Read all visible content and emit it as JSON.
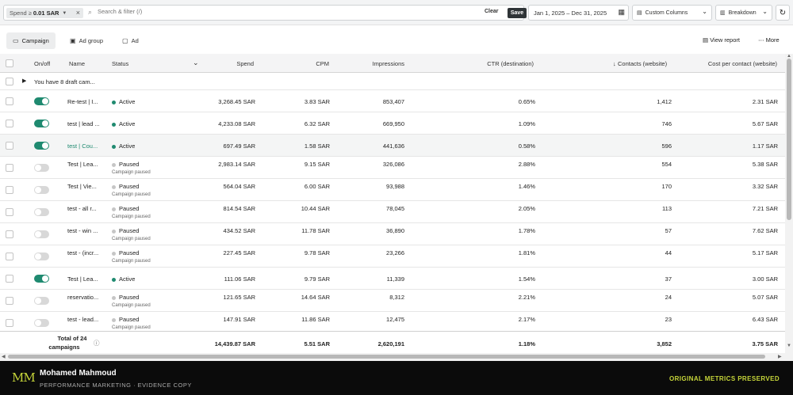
{
  "filter": {
    "chip_label": "Spend ≥",
    "chip_value": "0.01 SAR",
    "search_placeholder": "Search & filter (/)",
    "clear_label": "Clear",
    "save_label": "Save"
  },
  "date_range": "Jan 1, 2025 – Dec 31, 2025",
  "custom_columns_label": "Custom Columns",
  "breakdown_label": "Breakdown",
  "tabs": [
    {
      "label": "Campaign"
    },
    {
      "label": "Ad group"
    },
    {
      "label": "Ad"
    }
  ],
  "view_report_label": "View report",
  "more_label": "More",
  "columns": {
    "onoff": "On/off",
    "name": "Name",
    "status": "Status",
    "spend": "Spend",
    "cpm": "CPM",
    "impressions": "Impressions",
    "ctr": "CTR (destination)",
    "contacts": "Contacts (website)",
    "cost_per_contact": "Cost per contact (website)"
  },
  "draft_text": "You have 8 draft cam...",
  "rows": [
    {
      "name": "Re-test | I...",
      "status": "Active",
      "status_sub": "",
      "spend": "3,268.45 SAR",
      "cpm": "3.83 SAR",
      "impressions": "853,407",
      "ctr": "0.65%",
      "contacts": "1,412",
      "cpc": "2.31 SAR",
      "on": true
    },
    {
      "name": "test | lead ...",
      "status": "Active",
      "status_sub": "",
      "spend": "4,233.08 SAR",
      "cpm": "6.32 SAR",
      "impressions": "669,950",
      "ctr": "1.09%",
      "contacts": "746",
      "cpc": "5.67 SAR",
      "on": true
    },
    {
      "name": "test | Cou...",
      "status": "Active",
      "status_sub": "",
      "spend": "697.49 SAR",
      "cpm": "1.58 SAR",
      "impressions": "441,636",
      "ctr": "0.58%",
      "contacts": "596",
      "cpc": "1.17 SAR",
      "on": true
    },
    {
      "name": "Test | Lea...",
      "status": "Paused",
      "status_sub": "Campaign paused",
      "spend": "2,983.14 SAR",
      "cpm": "9.15 SAR",
      "impressions": "326,086",
      "ctr": "2.88%",
      "contacts": "554",
      "cpc": "5.38 SAR",
      "on": false
    },
    {
      "name": "Test | Vie...",
      "status": "Paused",
      "status_sub": "Campaign paused",
      "spend": "564.04 SAR",
      "cpm": "6.00 SAR",
      "impressions": "93,988",
      "ctr": "1.46%",
      "contacts": "170",
      "cpc": "3.32 SAR",
      "on": false
    },
    {
      "name": "test - all r...",
      "status": "Paused",
      "status_sub": "Campaign paused",
      "spend": "814.54 SAR",
      "cpm": "10.44 SAR",
      "impressions": "78,045",
      "ctr": "2.05%",
      "contacts": "113",
      "cpc": "7.21 SAR",
      "on": false
    },
    {
      "name": "test - win ...",
      "status": "Paused",
      "status_sub": "Campaign paused",
      "spend": "434.52 SAR",
      "cpm": "11.78 SAR",
      "impressions": "36,890",
      "ctr": "1.78%",
      "contacts": "57",
      "cpc": "7.62 SAR",
      "on": false
    },
    {
      "name": "test - (incr...",
      "status": "Paused",
      "status_sub": "Campaign paused",
      "spend": "227.45 SAR",
      "cpm": "9.78 SAR",
      "impressions": "23,266",
      "ctr": "1.81%",
      "contacts": "44",
      "cpc": "5.17 SAR",
      "on": false
    },
    {
      "name": "Test | Lea...",
      "status": "Active",
      "status_sub": "",
      "spend": "111.06 SAR",
      "cpm": "9.79 SAR",
      "impressions": "11,339",
      "ctr": "1.54%",
      "contacts": "37",
      "cpc": "3.00 SAR",
      "on": true
    },
    {
      "name": "reservatio...",
      "status": "Paused",
      "status_sub": "Campaign paused",
      "spend": "121.65 SAR",
      "cpm": "14.64 SAR",
      "impressions": "8,312",
      "ctr": "2.21%",
      "contacts": "24",
      "cpc": "5.07 SAR",
      "on": false
    },
    {
      "name": "test - lead...",
      "status": "Paused",
      "status_sub": "Campaign paused",
      "spend": "147.91 SAR",
      "cpm": "11.86 SAR",
      "impressions": "12,475",
      "ctr": "2.17%",
      "contacts": "23",
      "cpc": "6.43 SAR",
      "on": false
    }
  ],
  "totals": {
    "label_line1": "Total of 24",
    "label_line2": "campaigns",
    "spend": "14,439.87 SAR",
    "cpm": "5.51 SAR",
    "impressions": "2,620,191",
    "ctr": "1.18%",
    "contacts": "3,852",
    "cpc": "3.75 SAR"
  },
  "footer": {
    "author": "Mohamed Mahmoud",
    "subtitle": "PERFORMANCE MARKETING · EVIDENCE COPY",
    "note": "ORIGINAL METRICS PRESERVED",
    "logo_text": "MM"
  },
  "colors": {
    "accent": "#1f8a70",
    "brand_highlight": "#c7d63a",
    "footer_bg": "#0b0b0b"
  }
}
